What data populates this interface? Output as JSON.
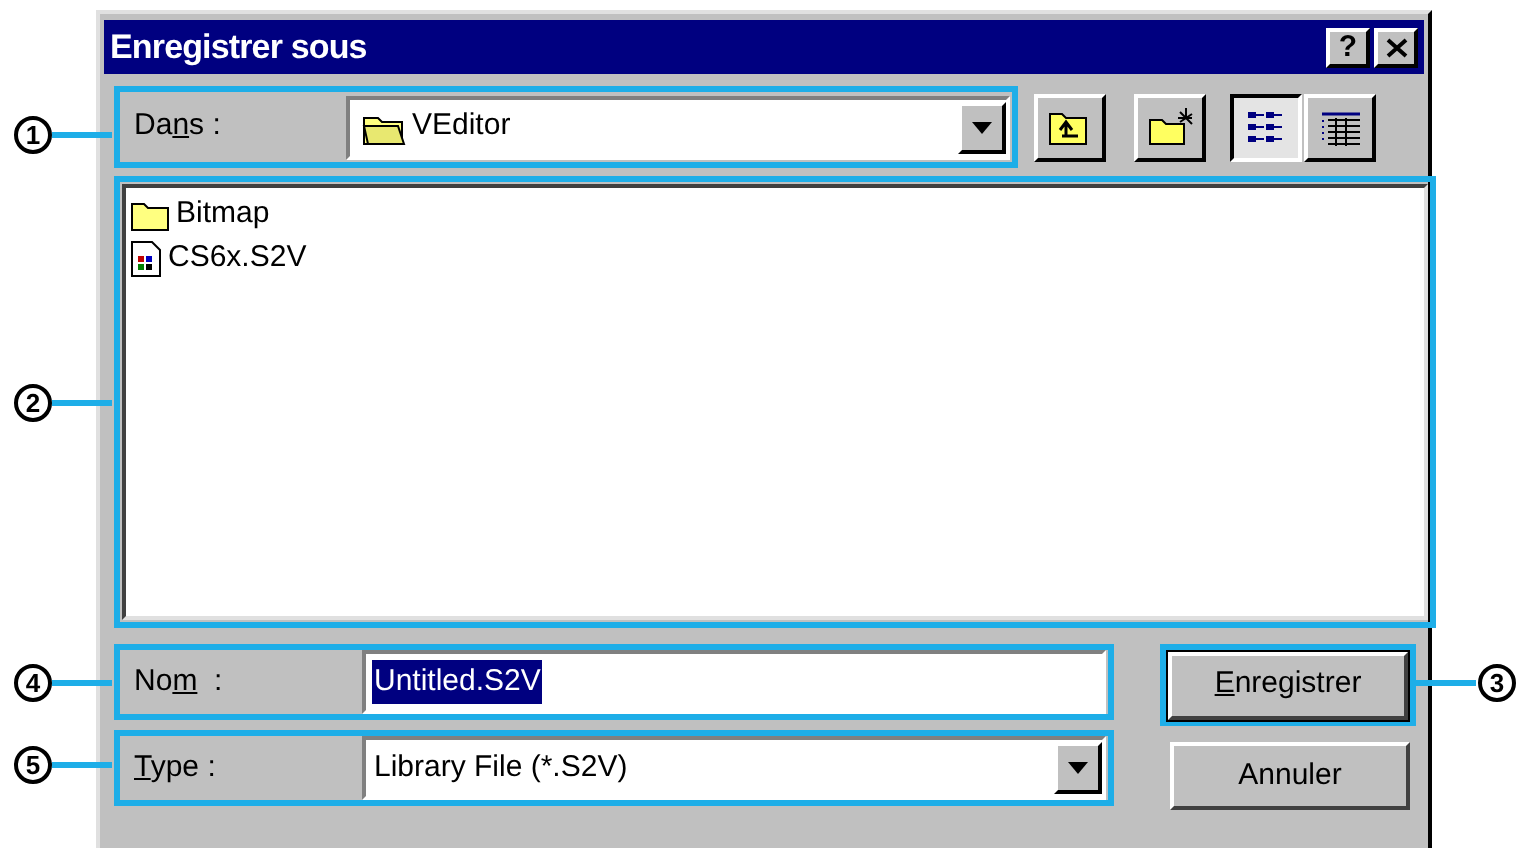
{
  "window": {
    "title": "Enregistrer sous",
    "help_button": "?"
  },
  "location": {
    "label": {
      "before": "Da",
      "mnemonic": "n",
      "after": "s :"
    },
    "value": "VEditor"
  },
  "toolbar": [
    {
      "kind": "up",
      "selected": false
    },
    {
      "kind": "newfolder",
      "selected": false
    },
    {
      "kind": "list",
      "selected": true
    },
    {
      "kind": "details",
      "selected": false
    }
  ],
  "files": [
    {
      "kind": "folder",
      "name": "Bitmap"
    },
    {
      "kind": "file",
      "name": "CS6x.S2V"
    }
  ],
  "filename": {
    "label": {
      "before": "No",
      "mnemonic": "m",
      "after": "  :"
    },
    "value": "Untitled.S2V"
  },
  "filetype": {
    "label": {
      "mnemonic": "T",
      "after": "ype :"
    },
    "value": "Library File (*.S2V)"
  },
  "buttons": [
    {
      "label": {
        "mnemonic": "E",
        "after": "nregistrer"
      },
      "default": true
    },
    {
      "label": {
        "after": "Annuler"
      },
      "default": false
    }
  ],
  "callouts": [
    "1",
    "2",
    "4",
    "3",
    "5"
  ]
}
